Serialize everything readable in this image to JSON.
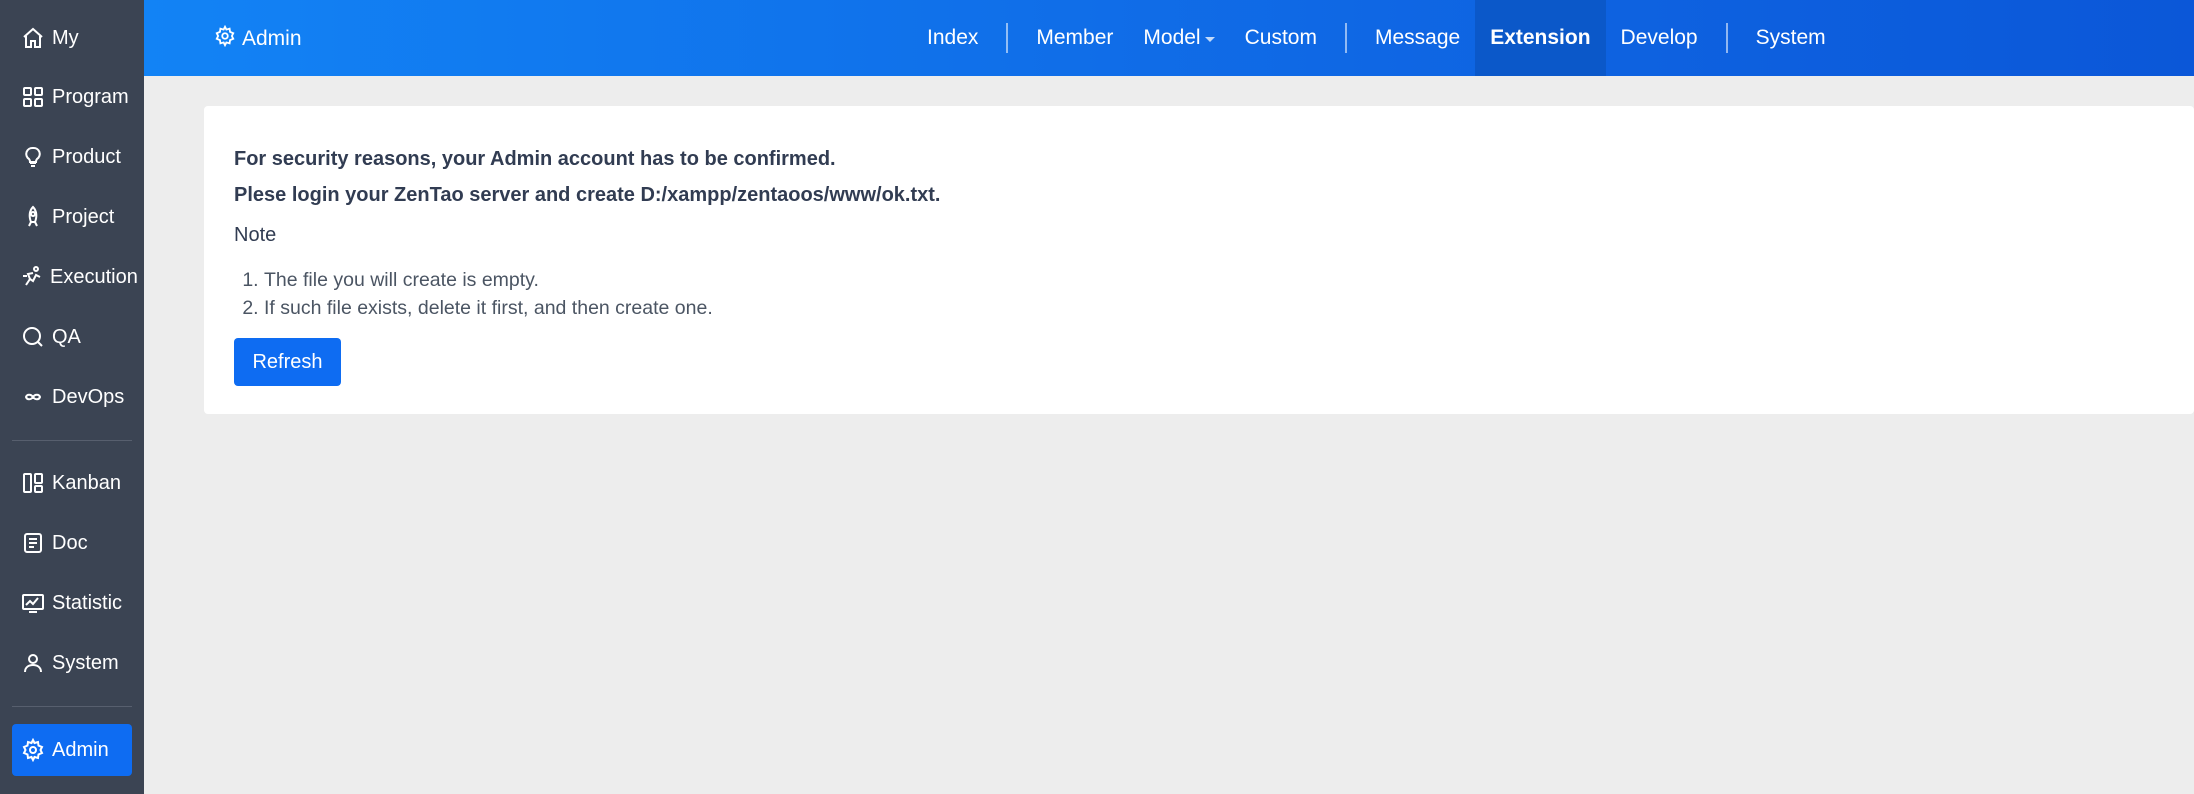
{
  "sidebar": {
    "items": [
      {
        "label": "My",
        "icon": "home-icon"
      },
      {
        "label": "Program",
        "icon": "grid-icon"
      },
      {
        "label": "Product",
        "icon": "bulb-icon"
      },
      {
        "label": "Project",
        "icon": "rocket-icon"
      },
      {
        "label": "Execution",
        "icon": "run-icon"
      },
      {
        "label": "QA",
        "icon": "magnifier-icon"
      },
      {
        "label": "DevOps",
        "icon": "infinity-icon"
      },
      {
        "label": "Kanban",
        "icon": "kanban-icon"
      },
      {
        "label": "Doc",
        "icon": "doc-icon"
      },
      {
        "label": "Statistic",
        "icon": "monitor-chart-icon"
      },
      {
        "label": "System",
        "icon": "user-icon"
      },
      {
        "label": "Admin",
        "icon": "gear-icon"
      }
    ],
    "active": "Admin"
  },
  "topbar": {
    "brand_label": "Admin",
    "nav": {
      "index": "Index",
      "member": "Member",
      "model": "Model",
      "custom": "Custom",
      "message": "Message",
      "extension": "Extension",
      "develop": "Develop",
      "system": "System"
    },
    "active_tab": "Extension"
  },
  "main": {
    "line1": "For security reasons, your Admin account has to be confirmed.",
    "line2": "Plese login your ZenTao server and create D:/xampp/zentaoos/www/ok.txt.",
    "note_title": "Note",
    "notes": [
      "The file you will create is empty.",
      "If such file exists, delete it first, and then create one."
    ],
    "refresh_label": "Refresh"
  },
  "colors": {
    "sidebar_bg": "#3b4453",
    "accent": "#0e6cf2",
    "topbar_start": "#1283f5",
    "topbar_end": "#0b57d8",
    "page_bg": "#ededed"
  }
}
